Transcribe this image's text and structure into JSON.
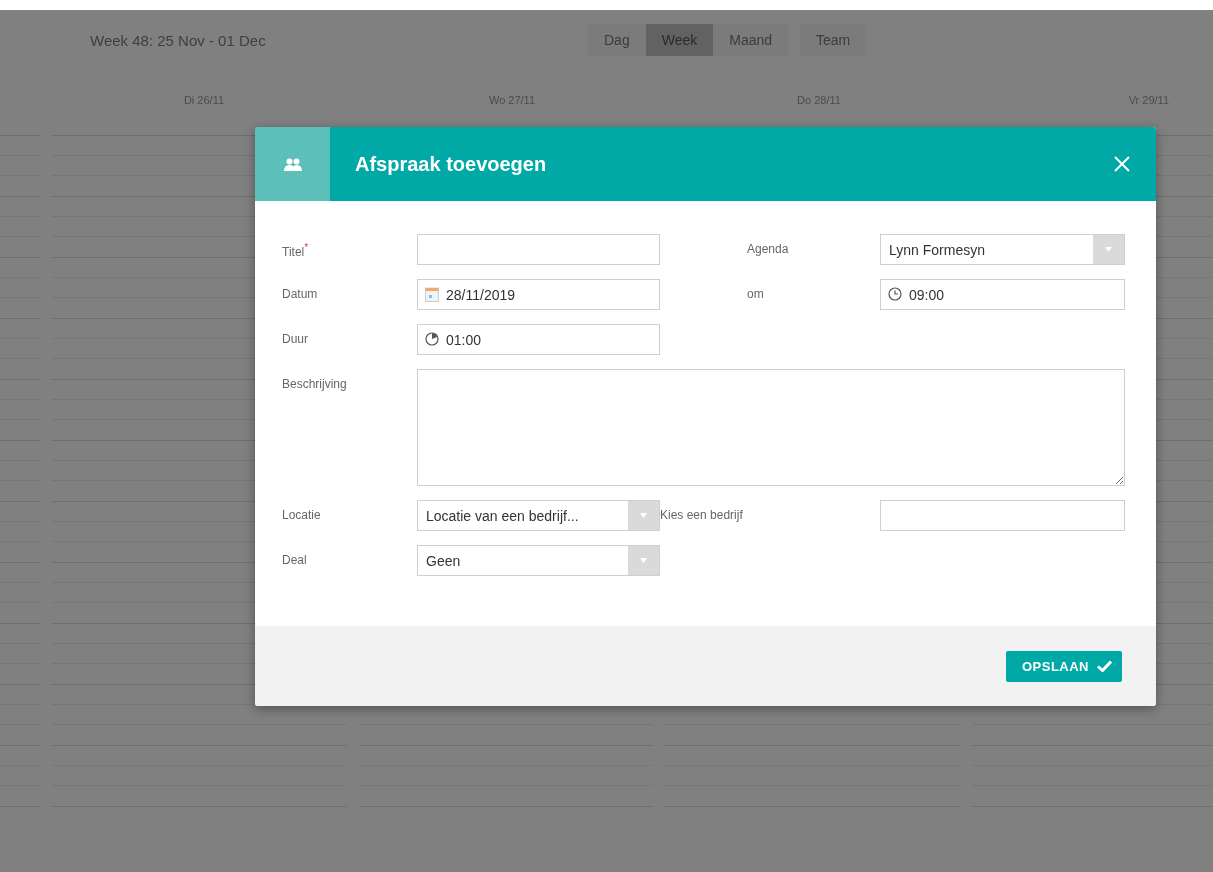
{
  "week_label": "Week 48: 25 Nov - 01 Dec",
  "view_tabs": [
    {
      "label": "Dag",
      "selected": false
    },
    {
      "label": "Week",
      "selected": true
    },
    {
      "label": "Maand",
      "selected": false
    },
    {
      "label": "Team",
      "selected": false
    }
  ],
  "day_headers": [
    "Di 26/11",
    "Wo 27/11",
    "Do 28/11",
    "Vr 29/11"
  ],
  "dialog": {
    "title": "Afspraak toevoegen",
    "rows": [
      [
        {
          "label": "Titel",
          "required_mark": "*",
          "kind": "text"
        },
        {
          "label": "Agenda",
          "kind": "select",
          "value": "Lynn Formesyn"
        }
      ],
      [
        {
          "label": "Datum",
          "kind": "date",
          "value": "28/11/2019"
        },
        {
          "label": "om",
          "kind": "time",
          "value": "09:00"
        }
      ],
      [
        {
          "label": "Duur",
          "kind": "duration",
          "value": "01:00"
        }
      ],
      [
        {
          "label": "Beschrijving",
          "kind": "textarea"
        }
      ],
      [
        {
          "label": "Locatie",
          "kind": "select",
          "value": "Locatie van een bedrijf..."
        },
        {
          "label": "Kies een bedrijf",
          "kind": "text"
        }
      ],
      [
        {
          "label": "Deal",
          "kind": "select",
          "value": "Geen"
        }
      ]
    ],
    "save_button": "OPSLAAN"
  }
}
